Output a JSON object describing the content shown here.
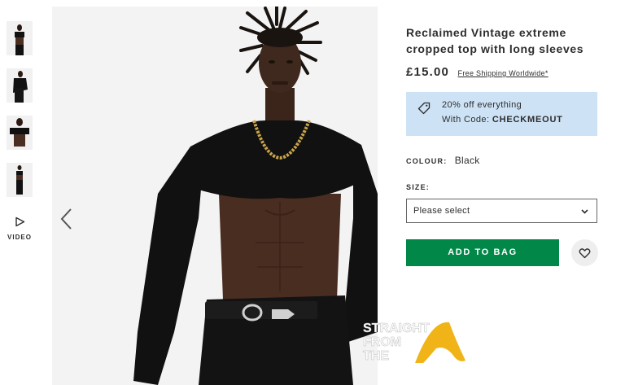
{
  "gallery": {
    "video_label": "VIDEO"
  },
  "product": {
    "title": "Reclaimed Vintage extreme cropped top with long sleeves",
    "price": "£15.00",
    "shipping_link": "Free Shipping Worldwide*"
  },
  "promo": {
    "line1": "20% off everything",
    "line2_prefix": "With Code: ",
    "code": "CHECKMEOUT"
  },
  "options": {
    "colour_label": "COLOUR:",
    "colour_value": "Black",
    "size_label": "SIZE:",
    "size_selected": "Please select"
  },
  "actions": {
    "add_to_bag": "ADD TO BAG"
  },
  "watermark": {
    "line1": "STRAIGHT",
    "line2": "FROM",
    "line3": "THE"
  },
  "colors": {
    "add_button": "#018849",
    "promo_bg": "#cde2f5",
    "text": "#2d2d2d"
  }
}
